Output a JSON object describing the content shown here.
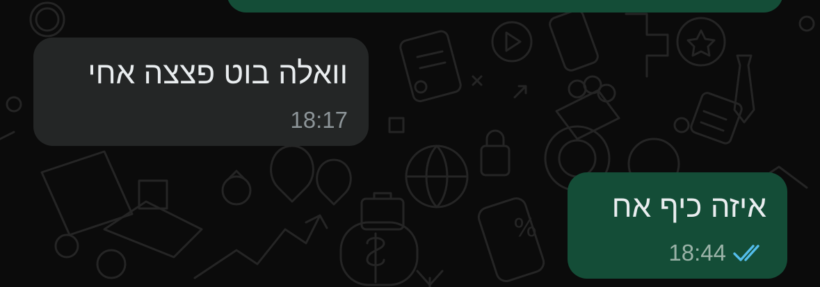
{
  "chat": {
    "incoming_message": {
      "text": "וואלה בוט פצצה אחי",
      "time": "18:17"
    },
    "outgoing_message": {
      "text": "איזה כיף אח",
      "time": "18:44",
      "status_icon": "double-check-read-icon"
    }
  },
  "colors": {
    "background": "#0b0b0b",
    "incoming_bubble": "#242626",
    "outgoing_bubble": "#144d37",
    "message_text": "#e9edef",
    "read_ticks": "#53bdeb"
  }
}
